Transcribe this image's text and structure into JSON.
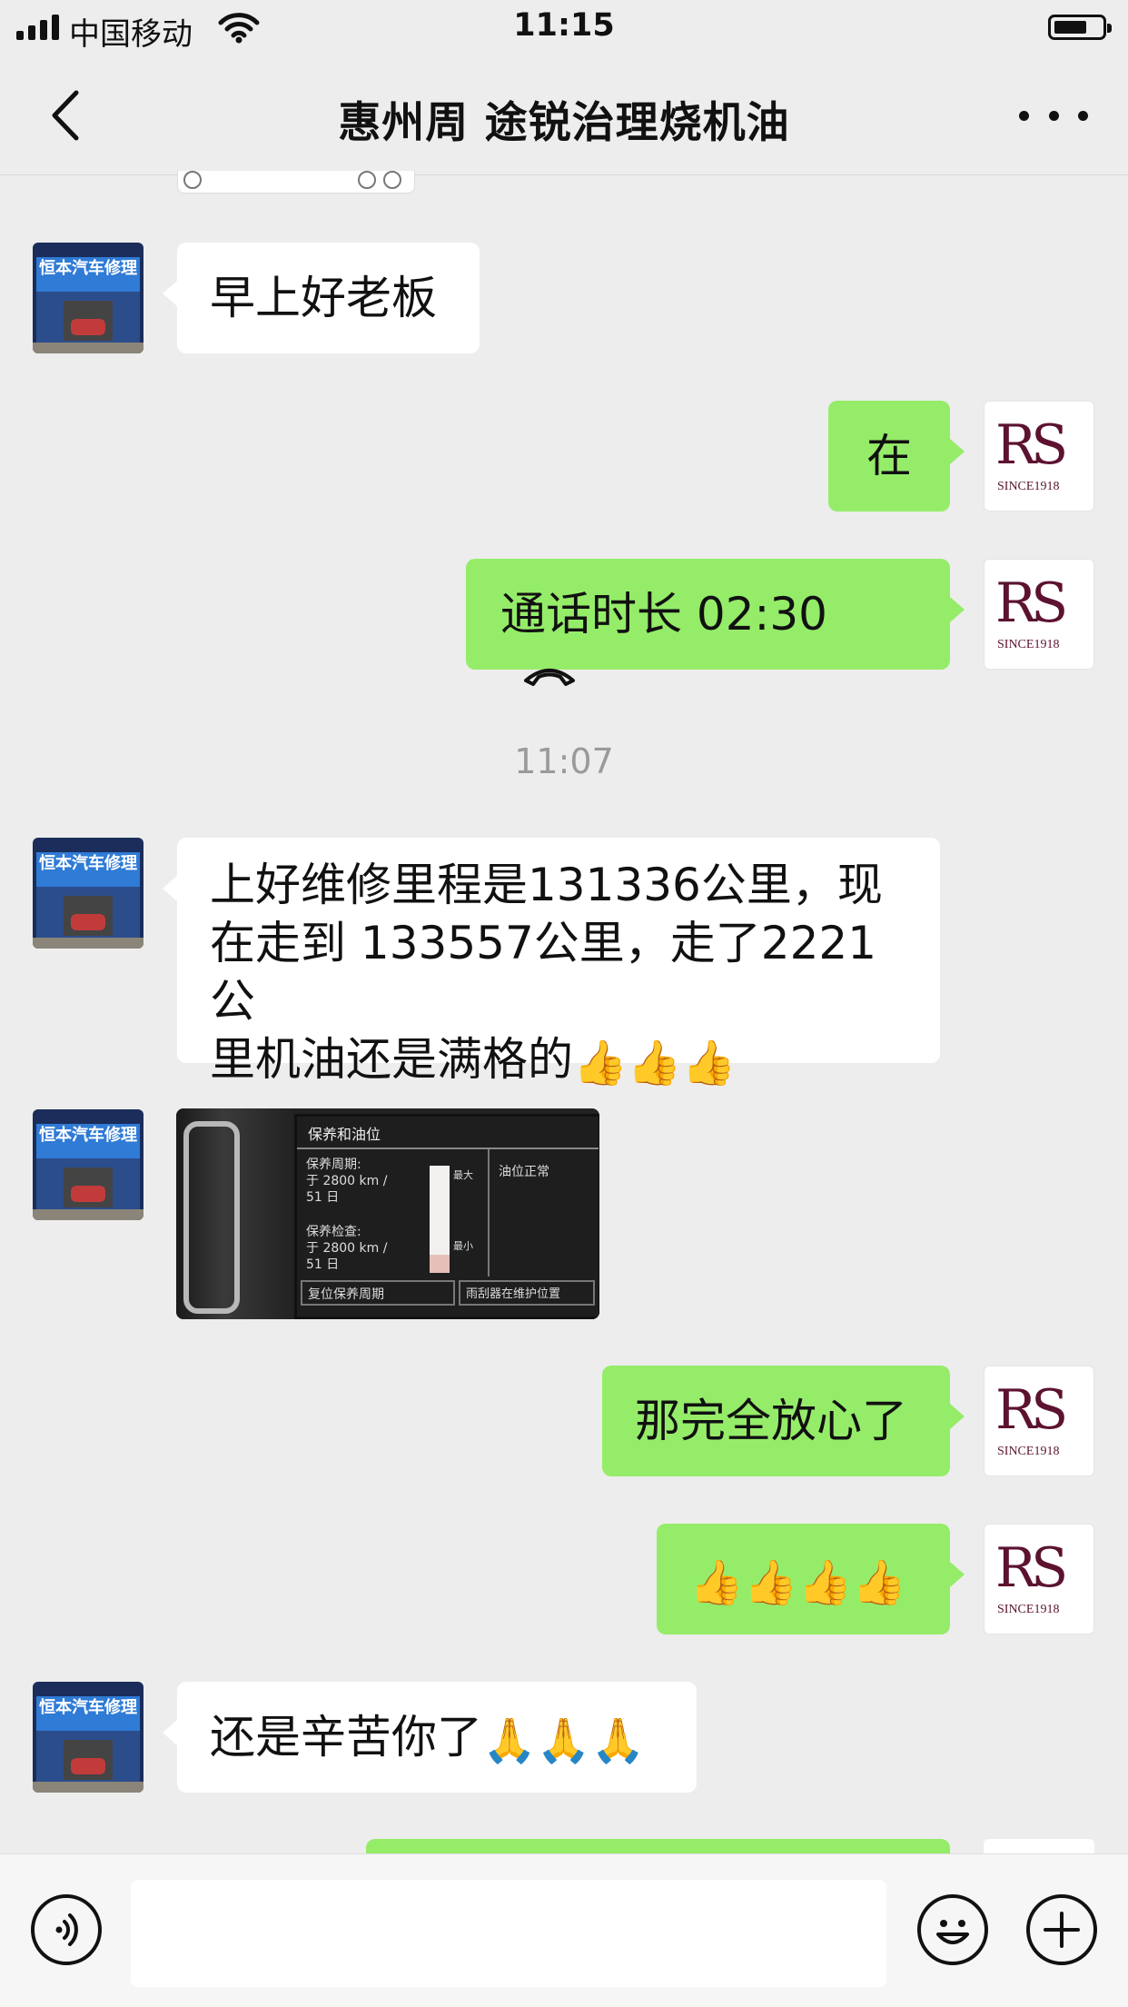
{
  "status": {
    "carrier": "中国移动",
    "time": "11:15",
    "battery_level": 0.7
  },
  "nav": {
    "title": "惠州周 途锐治理烧机油",
    "back_icon": "chevron-left-icon",
    "more_icon": "more-icon"
  },
  "messages": {
    "m1": "早上好老板",
    "m2": "在",
    "m3_label": "通话时长 02:30",
    "timestamp": "11:07",
    "m4_line1": "上好维修里程是131336公里，现",
    "m4_line2": "在走到 133557公里，走了2221公",
    "m4_line3": "里机油还是满格的",
    "m4_emoji": "👍👍👍",
    "m6": "那完全放心了",
    "m7_emoji": "👍👍👍👍",
    "m8_text": "还是辛苦你了",
    "m8_emoji": "🙏🙏🙏"
  },
  "avatars": {
    "shop_sign": "恒本汽车修理",
    "brand_mark": "RS",
    "brand_since": "SINCE1918"
  },
  "photo": {
    "screen_title": "保养和油位",
    "cycle_label": "保养周期:",
    "cycle_value_1": "于 2800 km /",
    "cycle_value_2": "51 日",
    "check_label": "保养检查:",
    "check_value_1": "于 2800 km /",
    "check_value_2": "51 日",
    "gauge_max": "最大",
    "gauge_min": "最小",
    "oil_status": "油位正常",
    "btn_reset": "复位保养周期",
    "btn_wiper": "雨刮器在维护位置"
  },
  "input": {
    "voice_icon": "voice-icon",
    "emoji_icon": "emoji-icon",
    "plus_icon": "plus-icon"
  }
}
